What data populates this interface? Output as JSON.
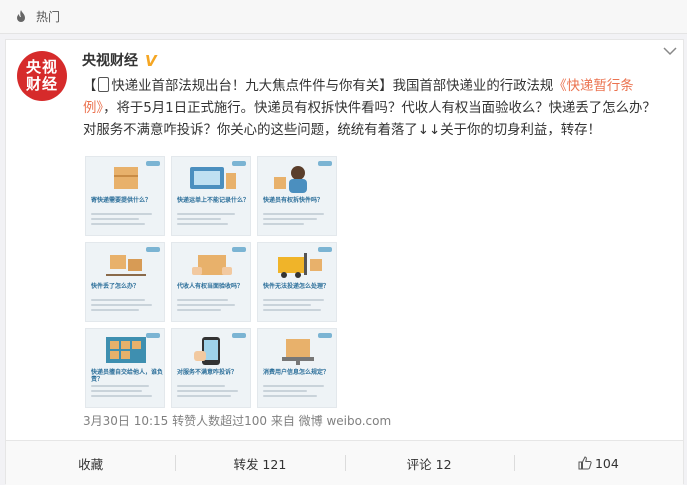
{
  "topbar": {
    "label": "热门",
    "icon": "fire-icon"
  },
  "post": {
    "avatar_lines": [
      "央视",
      "财经"
    ],
    "username": "央视财经",
    "verified_badge": "V",
    "text_prefix": "【",
    "text_1": "快递业首部法规出台！九大焦点件件与你有关】我国首部快递业的行政法规",
    "link_text": "《快递暂行条例》",
    "text_2": "，将于5月1日正式施行。快递员有权拆快件看吗？代收人有权当面验收么？快递丢了怎么办？对服务不满意咋投诉？你关心的这些问题，统统有着落了↓↓关于你的切身利益，转存！",
    "images": [
      {
        "title": "寄快递需要提供什么？"
      },
      {
        "title": "快递运单上不能记录什么？"
      },
      {
        "title": "快递员有权拆快件吗？"
      },
      {
        "title": "快件丢了怎么办？"
      },
      {
        "title": "代收人有权当面验收吗？"
      },
      {
        "title": "快件无法投递怎么处理？"
      },
      {
        "title": "快递员擅自交给他人，谁负责？"
      },
      {
        "title": "对服务不满意咋投诉？"
      },
      {
        "title": "消费用户信息怎么规定？"
      }
    ],
    "meta": "3月30日 10:15 转赞人数超过100 来自 微博 weibo.com"
  },
  "actions": {
    "favorite": "收藏",
    "repost": "转发 121",
    "comment": "评论 12",
    "like": "104"
  },
  "colors": {
    "link": "#eb7350",
    "brand_red": "#d62b2b",
    "verify": "#f5a623"
  }
}
